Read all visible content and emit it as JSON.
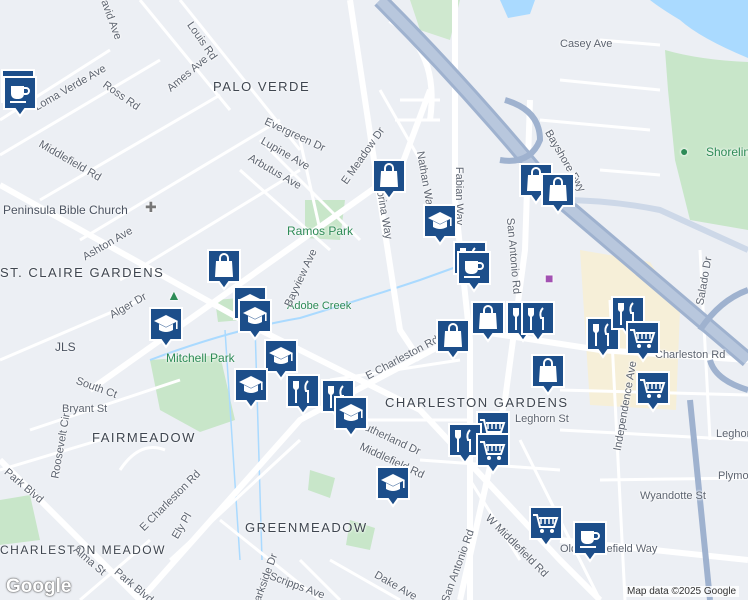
{
  "map": {
    "neighborhoods": [
      "PALO VERDE",
      "ST. CLAIRE GARDENS",
      "FAIRMEADOW",
      "GREENMEADOW",
      "CHARLESTON GARDENS",
      "CHARLESTON MEADOW"
    ],
    "parks": [
      "Ramos Park",
      "Mitchell Park",
      "Adobe Creek"
    ],
    "pois": [
      "Peninsula Bible Church",
      "JLS",
      "Shoreline"
    ],
    "streets": [
      "David Ave",
      "Louis Rd",
      "Ames Ave",
      "Loma Verde Ave",
      "Ross Rd",
      "Middlefield Rd",
      "Evergreen Dr",
      "Lupine Ave",
      "Arbutus Ave",
      "E Meadow Dr",
      "Corina Way",
      "Nathan Way",
      "Fabian Way",
      "San Antonio Rd",
      "Bayshore Fwy",
      "Casey Ave",
      "Ashton Ave",
      "Bayview Ave",
      "Alger Dr",
      "South Ct",
      "Bryant St",
      "Roosevelt Cir",
      "E Charleston Rd",
      "Sutherland Dr",
      "Leghorn St",
      "Independence Ave",
      "Charleston Rd",
      "W Middlefield Rd",
      "Wyandotte St",
      "Plymouth",
      "Salado Dr",
      "Alma St",
      "Park Blvd",
      "Ely Pl",
      "Parkside Dr",
      "Scripps Ave",
      "Dake Ave",
      "Old Middlefield Way"
    ],
    "logo": "Google",
    "attribution": "Map data ©2025 Google",
    "colors": {
      "marker": "#1c4e8a",
      "park": "#c8e6c9",
      "water": "#aadaff",
      "highway": "#9fb2cf"
    },
    "markers": [
      {
        "icon": "coffee-icon"
      },
      {
        "icon": "coffee-icon"
      },
      {
        "icon": "shopping-bag-icon"
      },
      {
        "icon": "school-icon"
      },
      {
        "icon": "shopping-bag-icon"
      },
      {
        "icon": "shopping-bag-icon"
      },
      {
        "icon": "restaurant-icon"
      },
      {
        "icon": "coffee-icon"
      },
      {
        "icon": "shopping-bag-icon"
      },
      {
        "icon": "school-icon"
      },
      {
        "icon": "school-icon"
      },
      {
        "icon": "school-icon"
      },
      {
        "icon": "school-icon"
      },
      {
        "icon": "school-icon"
      },
      {
        "icon": "restaurant-icon"
      },
      {
        "icon": "restaurant-icon"
      },
      {
        "icon": "school-icon"
      },
      {
        "icon": "shopping-bag-icon"
      },
      {
        "icon": "shopping-bag-icon"
      },
      {
        "icon": "restaurant-icon"
      },
      {
        "icon": "restaurant-icon"
      },
      {
        "icon": "shopping-bag-icon"
      },
      {
        "icon": "restaurant-icon"
      },
      {
        "icon": "restaurant-icon"
      },
      {
        "icon": "shopping-cart-icon"
      },
      {
        "icon": "shopping-cart-icon"
      },
      {
        "icon": "shopping-cart-icon"
      },
      {
        "icon": "restaurant-icon"
      },
      {
        "icon": "shopping-cart-icon"
      },
      {
        "icon": "school-icon"
      },
      {
        "icon": "shopping-cart-icon"
      },
      {
        "icon": "coffee-icon"
      }
    ]
  }
}
